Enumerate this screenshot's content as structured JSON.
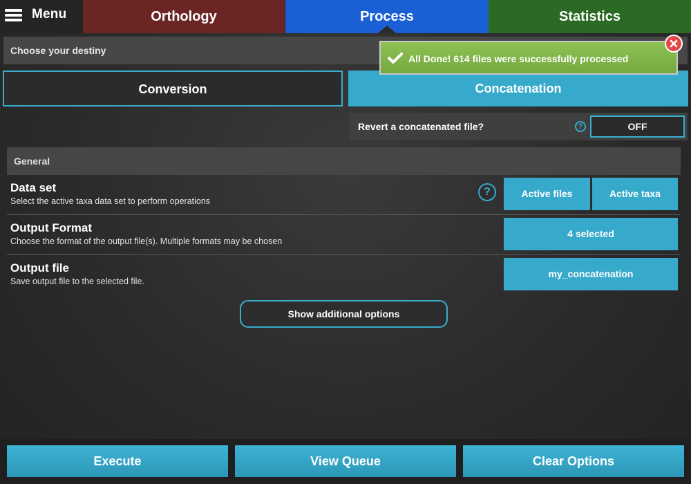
{
  "menu": {
    "label": "Menu"
  },
  "tabs": [
    {
      "label": "Orthology"
    },
    {
      "label": "Process"
    },
    {
      "label": "Statistics"
    }
  ],
  "destiny": {
    "label": "Choose your destiny"
  },
  "notification": {
    "text": "All Done! 614 files were successfully processed"
  },
  "modes": {
    "conversion": "Conversion",
    "concatenation": "Concatenation"
  },
  "revert": {
    "label": "Revert a concatenated file?",
    "help": "?",
    "toggle": "OFF"
  },
  "general": {
    "header": "General",
    "rows": [
      {
        "title": "Data set",
        "desc": "Select the active taxa data set to perform operations",
        "help": "?",
        "buttons": [
          "Active files",
          "Active taxa"
        ]
      },
      {
        "title": "Output Format",
        "desc": "Choose the format of the output file(s). Multiple formats may be chosen",
        "buttons": [
          "4 selected"
        ]
      },
      {
        "title": "Output file",
        "desc": "Save output file to the selected file.",
        "buttons": [
          "my_concatenation"
        ]
      }
    ],
    "more_label": "Show additional options"
  },
  "footer": {
    "execute": "Execute",
    "queue": "View Queue",
    "clear": "Clear Options"
  },
  "colors": {
    "accent": "#37aacb",
    "orthology": "#6b2525",
    "process": "#1a5fd4",
    "statistics": "#2a6a25",
    "success": "#7fb247",
    "close": "#e24a4a"
  }
}
